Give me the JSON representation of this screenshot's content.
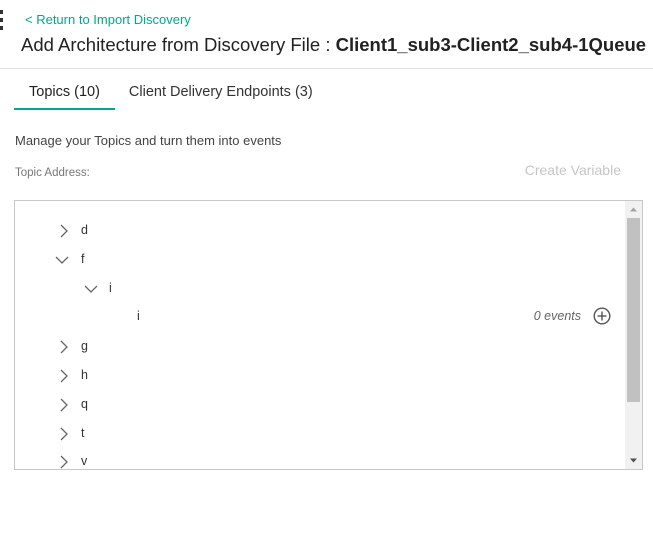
{
  "header": {
    "back_link": "< Return to Import Discovery",
    "title_prefix": "Add Architecture from Discovery File : ",
    "file_name": "Client1_sub3-Client2_sub4-1Queue"
  },
  "tabs": [
    {
      "label": "Topics (10)",
      "active": true
    },
    {
      "label": "Client Delivery Endpoints (3)",
      "active": false
    }
  ],
  "main": {
    "description": "Manage your Topics and turn them into events",
    "topic_address_label": "Topic Address:",
    "create_variable_label": "Create Variable"
  },
  "tree": {
    "nodes": [
      {
        "label": "d",
        "state": "collapsed",
        "level": 0
      },
      {
        "label": "f",
        "state": "expanded",
        "level": 0
      },
      {
        "label": "i",
        "state": "expanded",
        "level": 1
      },
      {
        "label": "i",
        "state": "leaf",
        "level": 2,
        "events": "0 events"
      },
      {
        "label": "g",
        "state": "collapsed",
        "level": 0
      },
      {
        "label": "h",
        "state": "collapsed",
        "level": 0
      },
      {
        "label": "q",
        "state": "collapsed",
        "level": 0
      },
      {
        "label": "t",
        "state": "collapsed",
        "level": 0
      },
      {
        "label": "v",
        "state": "collapsed",
        "level": 0
      }
    ]
  },
  "colors": {
    "accent": "#00a88e",
    "disabled_text": "#c6c6c6",
    "border": "#c8c8c8"
  },
  "icons": {
    "collapsed": "chevron-right-icon",
    "expanded": "chevron-down-icon",
    "add_event": "add-circle-icon"
  }
}
